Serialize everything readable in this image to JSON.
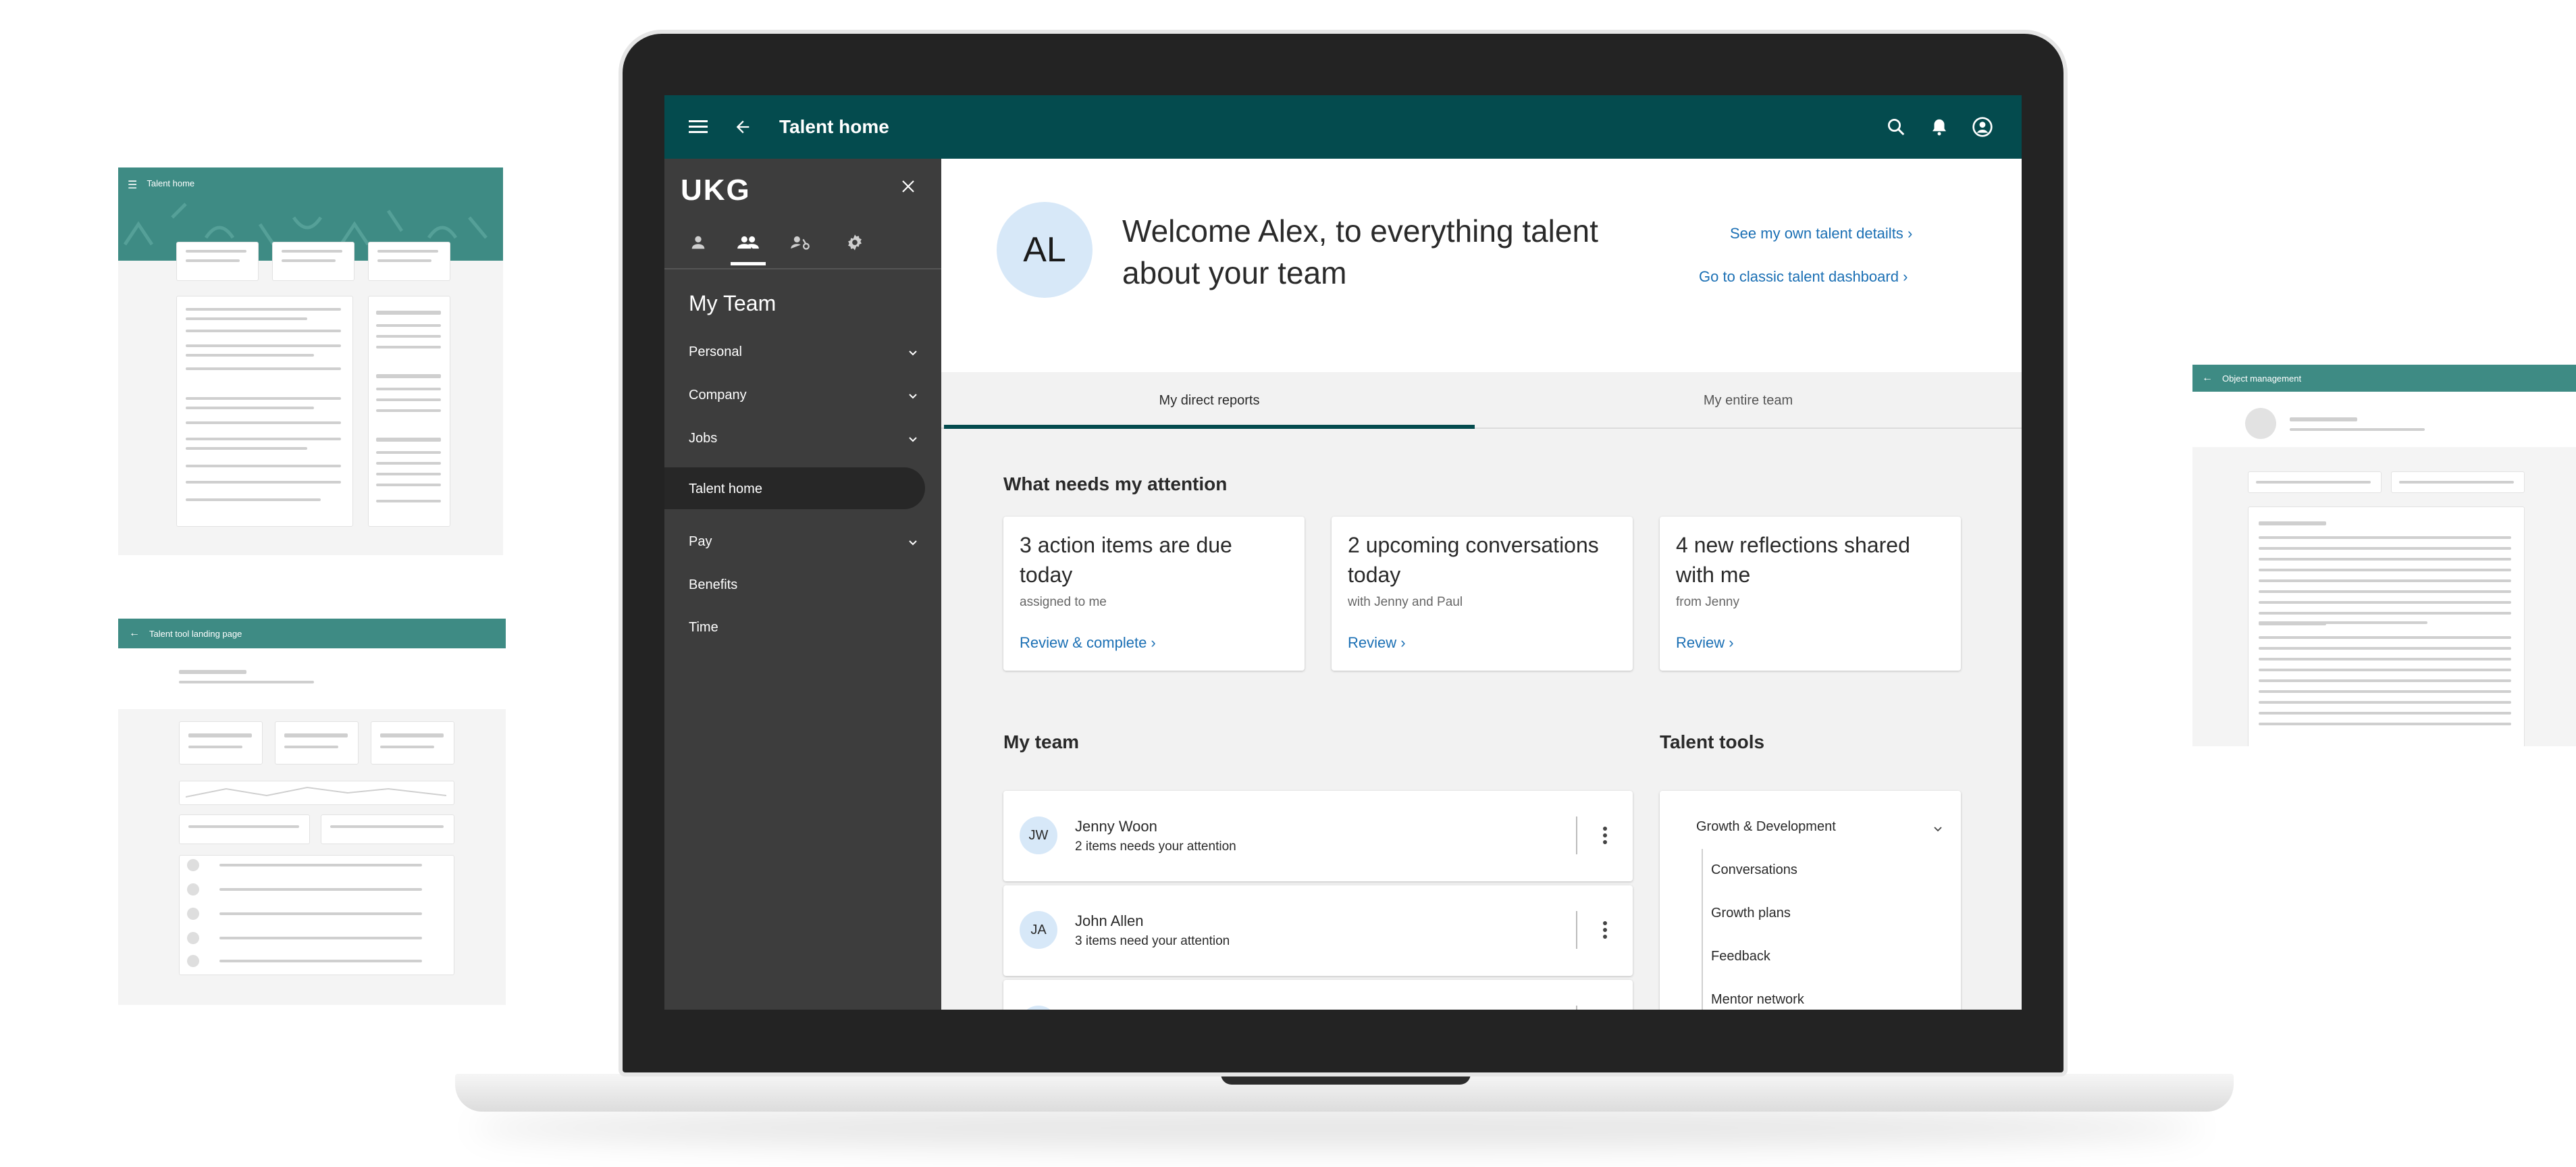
{
  "left_wire_1": {
    "title": "Talent home"
  },
  "left_wire_2": {
    "title": "Talent tool landing page"
  },
  "right_wire": {
    "title": "Object management"
  },
  "topbar": {
    "title": "Talent home"
  },
  "nav": {
    "logo": "UKG",
    "heading": "My Team",
    "items": [
      {
        "label": "Personal"
      },
      {
        "label": "Company"
      },
      {
        "label": "Jobs"
      },
      {
        "label": "Talent home"
      },
      {
        "label": "Pay"
      },
      {
        "label": "Benefits"
      },
      {
        "label": "Time"
      }
    ]
  },
  "welcome": {
    "avatar": "AL",
    "title": "Welcome Alex, to everything talent about your team",
    "link_own": "See my own talent detailts",
    "link_classic": "Go to classic talent dashboard"
  },
  "tabs": [
    {
      "label": "My direct reports",
      "active": true
    },
    {
      "label": "My entire team",
      "active": false
    }
  ],
  "attention": {
    "heading": "What needs my attention",
    "cards": [
      {
        "title": "3 action items are due today",
        "subtitle": "assigned to me",
        "link": "Review & complete"
      },
      {
        "title": "2 upcoming conversations today",
        "subtitle": "with Jenny and Paul",
        "link": "Review"
      },
      {
        "title": "4 new reflections shared with me",
        "subtitle": "from Jenny",
        "link": "Review"
      }
    ]
  },
  "team": {
    "heading": "My team",
    "members": [
      {
        "initials": "JW",
        "name": "Jenny Woon",
        "status": "2 items needs your attention"
      },
      {
        "initials": "JA",
        "name": "John Allen",
        "status": "3 items need your attention"
      }
    ]
  },
  "tools": {
    "heading": "Talent tools",
    "group": "Growth & Development",
    "items": [
      "Conversations",
      "Growth plans",
      "Feedback",
      "Mentor network"
    ]
  },
  "colors": {
    "topbar": "#044b4e",
    "nav": "#3d3d3d",
    "link": "#1a6fb4",
    "wire_header": "#3e8b84"
  }
}
